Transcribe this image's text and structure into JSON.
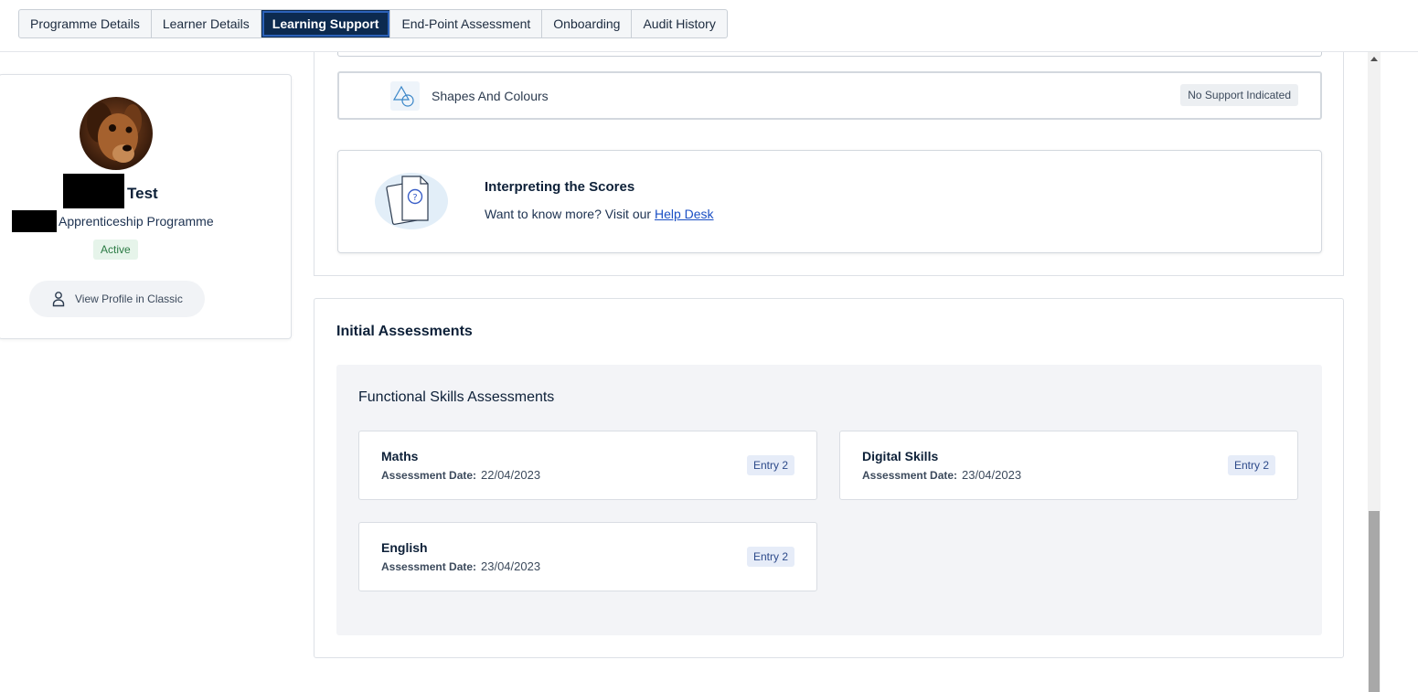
{
  "tabs": [
    {
      "label": "Programme Details",
      "active": false
    },
    {
      "label": "Learner Details",
      "active": false
    },
    {
      "label": "Learning Support",
      "active": true
    },
    {
      "label": "End-Point Assessment",
      "active": false
    },
    {
      "label": "Onboarding",
      "active": false
    },
    {
      "label": "Audit History",
      "active": false
    }
  ],
  "profile": {
    "name_suffix": "Test",
    "programme": "Apprenticeship Programme",
    "status": "Active",
    "view_profile_label": "View Profile in Classic"
  },
  "support": {
    "shapes_label": "Shapes And Colours",
    "shapes_badge": "No Support Indicated"
  },
  "scores": {
    "title": "Interpreting the Scores",
    "text": "Want to know more? Visit our ",
    "link": "Help Desk"
  },
  "initial_assessments": {
    "title": "Initial Assessments",
    "functional_skills": {
      "title": "Functional Skills Assessments",
      "date_label": "Assessment Date:",
      "items": [
        {
          "subject": "Maths",
          "date": "22/04/2023",
          "level": "Entry 2"
        },
        {
          "subject": "Digital Skills",
          "date": "23/04/2023",
          "level": "Entry 2"
        },
        {
          "subject": "English",
          "date": "23/04/2023",
          "level": "Entry 2"
        }
      ]
    }
  },
  "colors": {
    "primary": "#0c2a4f",
    "link": "#1a4fc4",
    "active_status": "#2a7a43"
  }
}
